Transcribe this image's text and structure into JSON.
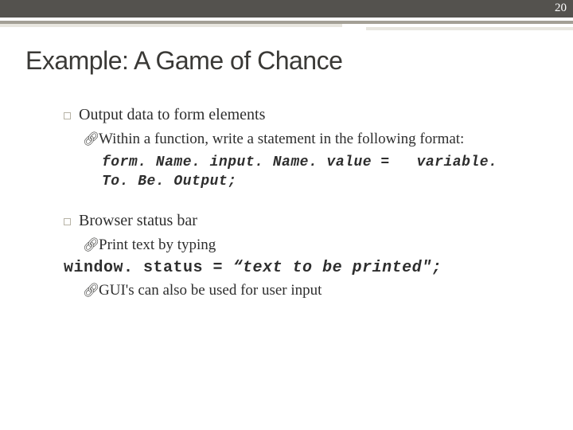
{
  "page_number": "20",
  "title": "Example: A Game of Chance",
  "items": [
    {
      "title": "Output data to form elements",
      "subs": [
        {
          "type": "text",
          "text": "Within a function, write a statement in the following format:"
        },
        {
          "type": "code",
          "left": "form. Name. input. Name. value = ",
          "right": "variable. To. Be. Output;"
        }
      ]
    },
    {
      "title": "Browser status bar",
      "subs": [
        {
          "type": "text",
          "text": "Print text by typing"
        },
        {
          "type": "codeinline",
          "left": "window. status = ",
          "right": "“text to be printed\";"
        },
        {
          "type": "text",
          "text": "GUI's can also be used for user input"
        }
      ]
    }
  ]
}
